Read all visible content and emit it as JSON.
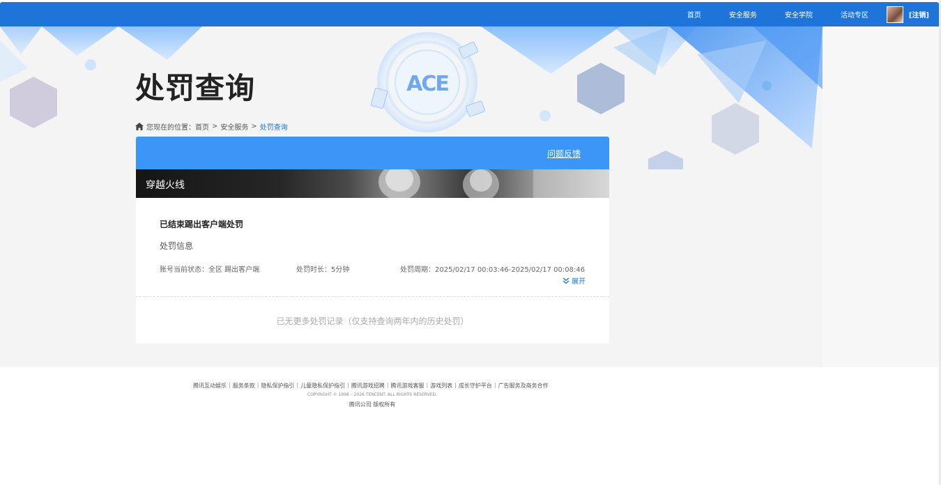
{
  "nav": {
    "items": [
      "首页",
      "安全服务",
      "安全学院",
      "活动专区"
    ],
    "logout": "[注销]"
  },
  "header": {
    "title": "处罚查询"
  },
  "breadcrumb": {
    "prefix": "您现在的位置：",
    "items": [
      "首页",
      "安全服务",
      "处罚查询"
    ],
    "separator": ">"
  },
  "card": {
    "feedback": "问题反馈",
    "game": "穿越火线",
    "record": {
      "title": "已结束踢出客户端处罚",
      "subtitle": "处罚信息",
      "status": "账号当前状态：全区 踢出客户端",
      "duration": "处罚时长：5分钟",
      "period": "处罚周期：2025/02/17 00:03:46-2025/02/17 00:08:46",
      "expand": "展开"
    },
    "no_more": "已无更多处罚记录（仅支持查询两年内的历史处罚）"
  },
  "footer": {
    "links": [
      "腾讯互动娱乐",
      "服务条款",
      "隐私保护指引",
      "儿童隐私保护指引",
      "腾讯游戏招聘",
      "腾讯游戏客服",
      "游戏列表",
      "成长守护平台",
      "广告服务及商务合作"
    ],
    "separator": "|",
    "copyright": "COPYRIGHT © 1998 – 2026 TENCENT. ALL RIGHTS RESERVED.",
    "company": "腾讯公司 版权所有"
  },
  "colors": {
    "nav_bg": "#1f74d9",
    "card_head": "#3b96f7",
    "accent": "#1f74d9"
  },
  "icons": {
    "home": "home-icon",
    "expand": "double-chevron-down-icon",
    "logo": "ace-logo-icon"
  }
}
